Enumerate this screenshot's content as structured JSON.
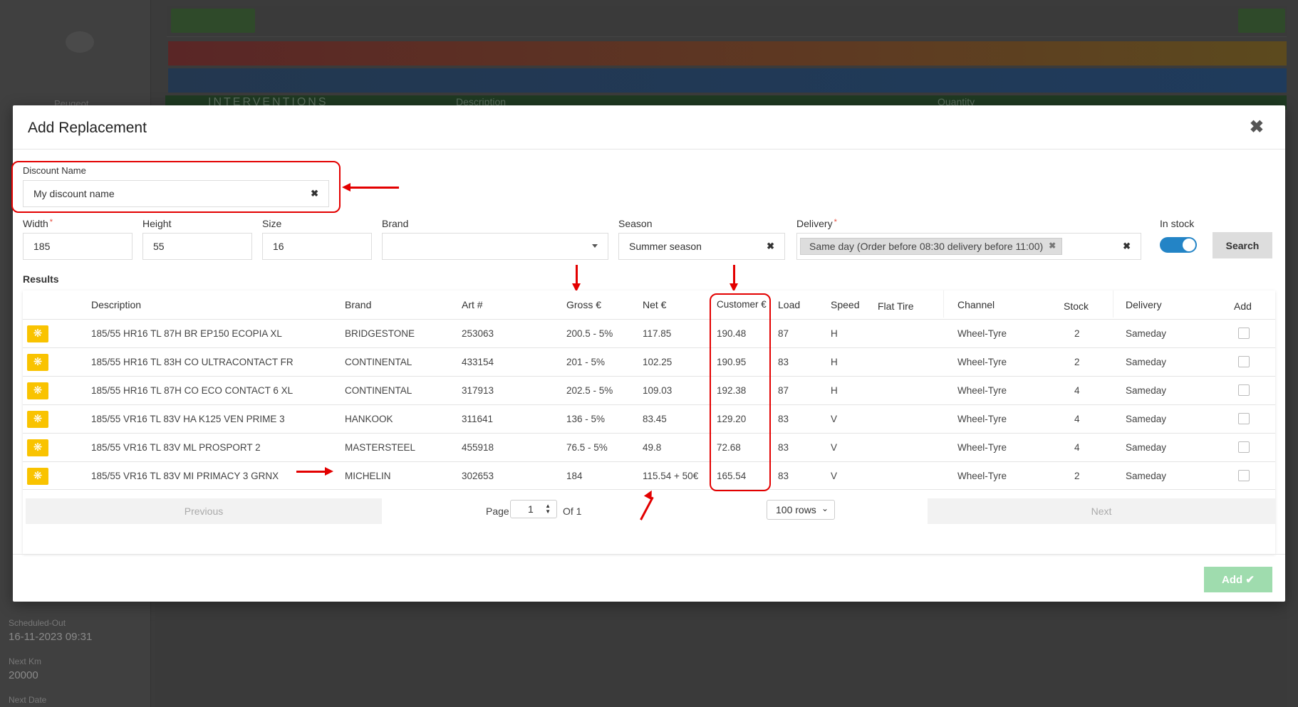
{
  "background": {
    "peugeot": "Peugeot",
    "interventions": "INTERVENTIONS",
    "col_description": "Description",
    "col_quantity": "Quantity",
    "scheduled_out_label": "Scheduled-Out",
    "scheduled_out_value": "16-11-2023 09:31",
    "next_km_label": "Next Km",
    "next_km_value": "20000",
    "next_date_label": "Next Date"
  },
  "modal": {
    "title": "Add Replacement",
    "close_icon": "close-icon",
    "discount_name": {
      "label": "Discount Name",
      "value": "My discount name"
    },
    "width": {
      "label": "Width",
      "value": "185"
    },
    "height": {
      "label": "Height",
      "value": "55"
    },
    "size": {
      "label": "Size",
      "value": "16"
    },
    "brand": {
      "label": "Brand",
      "value": ""
    },
    "season": {
      "label": "Season",
      "value": "Summer season"
    },
    "delivery": {
      "label": "Delivery",
      "tag": "Same day (Order before 08:30 delivery before 11:00)"
    },
    "in_stock": {
      "label": "In stock",
      "checked": true
    },
    "search_label": "Search",
    "results_label": "Results",
    "columns": [
      "Description",
      "Brand",
      "Art #",
      "Gross €",
      "Net €",
      "Customer €",
      "Load",
      "Speed",
      "Flat Tire",
      "Channel",
      "Stock",
      "Delivery",
      "Add"
    ],
    "rows": [
      {
        "description": "185/55 HR16 TL 87H BR EP150 ECOPIA XL",
        "brand": "BRIDGESTONE",
        "art": "253063",
        "gross": "200.5 - 5%",
        "net": "117.85",
        "customer": "190.48",
        "load": "87",
        "speed": "H",
        "channel": "Wheel-Tyre",
        "stock": "2",
        "delivery": "Sameday"
      },
      {
        "description": "185/55 HR16 TL 83H CO ULTRACONTACT FR",
        "brand": "CONTINENTAL",
        "art": "433154",
        "gross": "201 - 5%",
        "net": "102.25",
        "customer": "190.95",
        "load": "83",
        "speed": "H",
        "channel": "Wheel-Tyre",
        "stock": "2",
        "delivery": "Sameday"
      },
      {
        "description": "185/55 HR16 TL 87H CO ECO CONTACT 6 XL",
        "brand": "CONTINENTAL",
        "art": "317913",
        "gross": "202.5 - 5%",
        "net": "109.03",
        "customer": "192.38",
        "load": "87",
        "speed": "H",
        "channel": "Wheel-Tyre",
        "stock": "4",
        "delivery": "Sameday"
      },
      {
        "description": "185/55 VR16 TL 83V HA K125 VEN PRIME 3",
        "brand": "HANKOOK",
        "art": "311641",
        "gross": "136 - 5%",
        "net": "83.45",
        "customer": "129.20",
        "load": "83",
        "speed": "V",
        "channel": "Wheel-Tyre",
        "stock": "4",
        "delivery": "Sameday"
      },
      {
        "description": "185/55 VR16 TL 83V ML PROSPORT 2",
        "brand": "MASTERSTEEL",
        "art": "455918",
        "gross": "76.5 - 5%",
        "net": "49.8",
        "customer": "72.68",
        "load": "83",
        "speed": "V",
        "channel": "Wheel-Tyre",
        "stock": "4",
        "delivery": "Sameday"
      },
      {
        "description": "185/55 VR16 TL 83V MI PRIMACY 3 GRNX",
        "brand": "MICHELIN",
        "art": "302653",
        "gross": "184",
        "net": "115.54 + 50€",
        "customer": "165.54",
        "load": "83",
        "speed": "V",
        "channel": "Wheel-Tyre",
        "stock": "2",
        "delivery": "Sameday"
      }
    ],
    "pager": {
      "previous": "Previous",
      "page_label": "Page",
      "page_value": "1",
      "of_label": "Of 1",
      "rows_value": "100 rows",
      "next": "Next"
    },
    "add_label": "Add"
  }
}
